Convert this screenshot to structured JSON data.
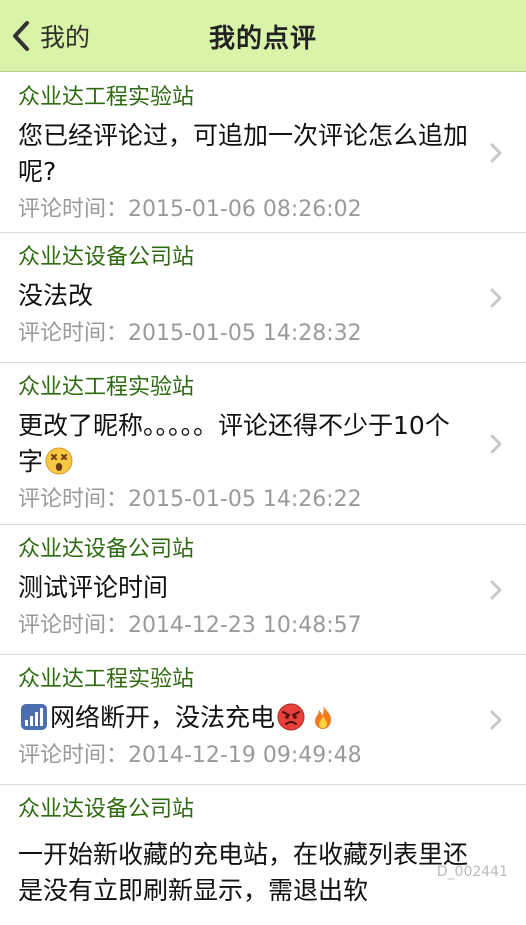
{
  "navbar": {
    "back_label": "我的",
    "title": "我的点评",
    "background": "#d9f3a9"
  },
  "colors": {
    "station": "#2e6b10",
    "time": "#9a9a9a",
    "chevron": "#c7c7cc"
  },
  "reviews": [
    {
      "station": "众业达工程实验站",
      "comment": "您已经评论过，可追加一次评论怎么追加呢?",
      "time": "评论时间：2015-01-06 08:26:02"
    },
    {
      "station": "众业达设备公司站",
      "comment": "没法改",
      "time": "评论时间：2015-01-05 14:28:32"
    },
    {
      "station": "众业达工程实验站",
      "comment": "更改了昵称。。。。。评论还得不少于10个字",
      "comment_icons": [
        "dizzy-face-emoji"
      ],
      "time": "评论时间：2015-01-05 14:26:22"
    },
    {
      "station": "众业达设备公司站",
      "comment": "测试评论时间",
      "time": "评论时间：2014-12-23 10:48:57"
    },
    {
      "station": "众业达工程实验站",
      "comment_lead_icon": "signal-bars-emoji",
      "comment": "网络断开，没法充电",
      "comment_icons": [
        "angry-face-emoji",
        "fire-emoji"
      ],
      "time": "评论时间：2014-12-19 09:49:48"
    },
    {
      "station": "众业达设备公司站",
      "comment": "一开始新收藏的充电站，在收藏列表里还是没有立即刷新显示，需退出软"
    }
  ],
  "watermark": {
    "right_text": "D_002441"
  }
}
